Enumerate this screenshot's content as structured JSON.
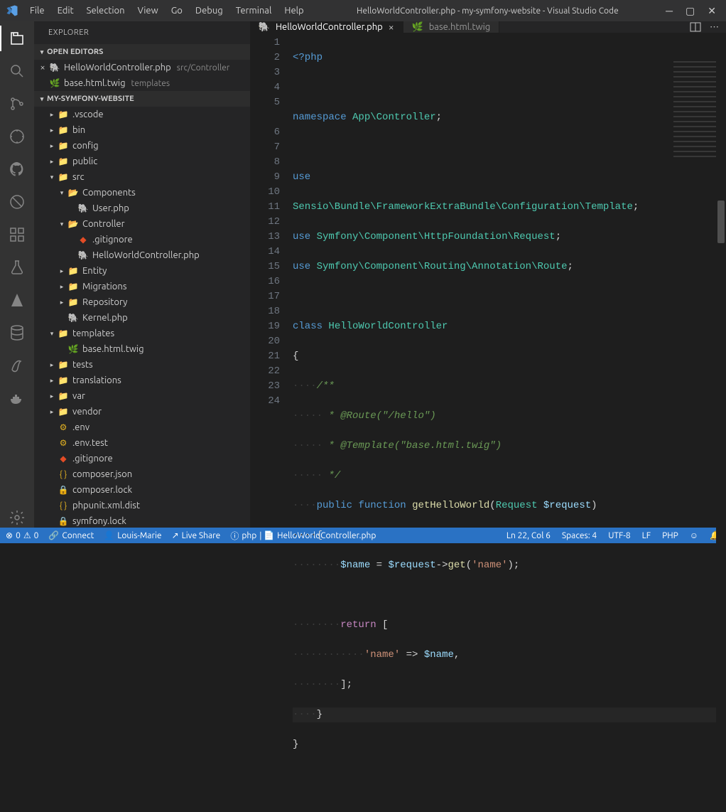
{
  "title": "HelloWorldController.php - my-symfony-website - Visual Studio Code",
  "menu": [
    "File",
    "Edit",
    "Selection",
    "View",
    "Go",
    "Debug",
    "Terminal",
    "Help"
  ],
  "sidebar_title": "EXPLORER",
  "open_editors_header": "OPEN EDITORS",
  "open_editors": [
    {
      "name": "HelloWorldController.php",
      "detail": "src/Controller",
      "icon": "php"
    },
    {
      "name": "base.html.twig",
      "detail": "templates",
      "icon": "twig"
    }
  ],
  "project_header": "MY-SYMFONY-WEBSITE",
  "tree": [
    {
      "d": 1,
      "tw": "▸",
      "icon": "folder",
      "name": ".vscode"
    },
    {
      "d": 1,
      "tw": "▸",
      "icon": "folder",
      "name": "bin"
    },
    {
      "d": 1,
      "tw": "▸",
      "icon": "folder",
      "name": "config"
    },
    {
      "d": 1,
      "tw": "▸",
      "icon": "folder",
      "name": "public"
    },
    {
      "d": 1,
      "tw": "▾",
      "icon": "folder-green",
      "name": "src"
    },
    {
      "d": 2,
      "tw": "▾",
      "icon": "folder-open",
      "name": "Components"
    },
    {
      "d": 3,
      "tw": "",
      "icon": "php",
      "name": "User.php"
    },
    {
      "d": 2,
      "tw": "▾",
      "icon": "folder-open",
      "name": "Controller"
    },
    {
      "d": 3,
      "tw": "",
      "icon": "gitignore",
      "name": ".gitignore"
    },
    {
      "d": 3,
      "tw": "",
      "icon": "php",
      "name": "HelloWorldController.php"
    },
    {
      "d": 2,
      "tw": "▸",
      "icon": "folder",
      "name": "Entity"
    },
    {
      "d": 2,
      "tw": "▸",
      "icon": "folder",
      "name": "Migrations"
    },
    {
      "d": 2,
      "tw": "▸",
      "icon": "folder",
      "name": "Repository"
    },
    {
      "d": 2,
      "tw": "",
      "icon": "php",
      "name": "Kernel.php"
    },
    {
      "d": 1,
      "tw": "▾",
      "icon": "folder",
      "name": "templates"
    },
    {
      "d": 2,
      "tw": "",
      "icon": "twig",
      "name": "base.html.twig"
    },
    {
      "d": 1,
      "tw": "▸",
      "icon": "folder",
      "name": "tests"
    },
    {
      "d": 1,
      "tw": "▸",
      "icon": "folder",
      "name": "translations"
    },
    {
      "d": 1,
      "tw": "▸",
      "icon": "folder",
      "name": "var"
    },
    {
      "d": 1,
      "tw": "▸",
      "icon": "folder",
      "name": "vendor"
    },
    {
      "d": 1,
      "tw": "",
      "icon": "env",
      "name": ".env"
    },
    {
      "d": 1,
      "tw": "",
      "icon": "env",
      "name": ".env.test"
    },
    {
      "d": 1,
      "tw": "",
      "icon": "gitignore",
      "name": ".gitignore"
    },
    {
      "d": 1,
      "tw": "",
      "icon": "json",
      "name": "composer.json"
    },
    {
      "d": 1,
      "tw": "",
      "icon": "lock",
      "name": "composer.lock"
    },
    {
      "d": 1,
      "tw": "",
      "icon": "json",
      "name": "phpunit.xml.dist"
    },
    {
      "d": 1,
      "tw": "",
      "icon": "lock-gold",
      "name": "symfony.lock"
    }
  ],
  "tabs": [
    {
      "name": "HelloWorldController.php",
      "icon": "php",
      "active": true
    },
    {
      "name": "base.html.twig",
      "icon": "twig",
      "active": false
    }
  ],
  "code": {
    "l1": "<?php",
    "l3_ns": "namespace",
    "l3_app": "App\\Controller",
    "l3_semi": ";",
    "l5_use": "use",
    "l5b": "Sensio\\Bundle\\FrameworkExtraBundle\\Configuration\\Template",
    "l6": "Symfony\\Component\\HttpFoundation\\Request",
    "l7": "Symfony\\Component\\Routing\\Annotation\\Route",
    "l9_class": "class",
    "l9_name": "HelloWorldController",
    "l10": "{",
    "l11": "/**",
    "l12": " * @Route(\"/hello\")",
    "l13": " * @Template(\"base.html.twig\")",
    "l14": " */",
    "l15_public": "public",
    "l15_function": "function",
    "l15_name": "getHelloWorld",
    "l15_req": "Request",
    "l15_var": "$request",
    "l16": "{",
    "l17_name": "$name",
    "l17_eq": " = ",
    "l17_req": "$request",
    "l17_arrow": "->",
    "l17_get": "get",
    "l17_p1": "(",
    "l17_str": "'name'",
    "l17_p2": ");",
    "l19_return": "return",
    "l19_brk": " [",
    "l20_str": "'name'",
    "l20_arrow": " => ",
    "l20_var": "$name",
    "l20_comma": ",",
    "l21": "];",
    "l22": "}",
    "l23": "}"
  },
  "status": {
    "errors": "0",
    "warnings": "0",
    "connect": "Connect",
    "author": "Louis-Marie",
    "liveshare": "Live Share",
    "lang_left": "php",
    "file": "HelloWorldController.php",
    "pos": "Ln 22, Col 6",
    "spaces": "Spaces: 4",
    "enc": "UTF-8",
    "eol": "LF",
    "lang": "PHP"
  }
}
